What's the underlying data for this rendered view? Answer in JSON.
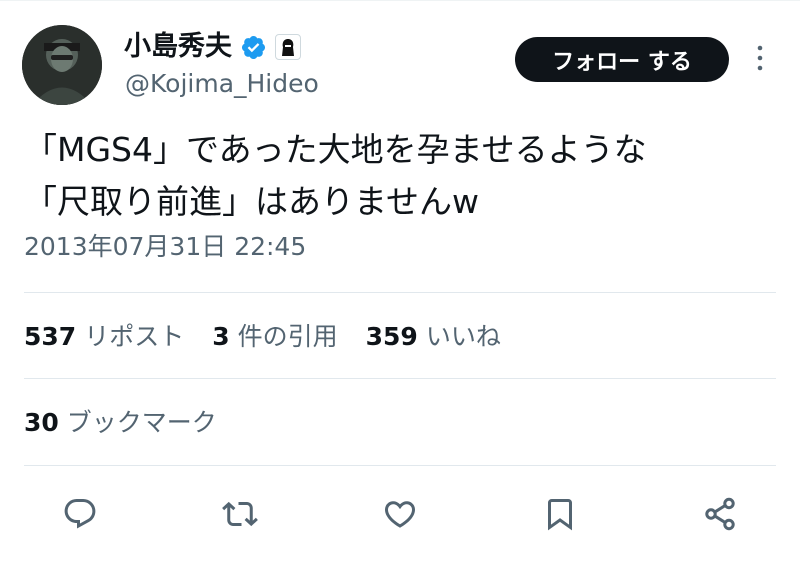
{
  "author": {
    "display_name": "小島秀夫",
    "handle": "@Kojima_Hideo"
  },
  "follow_label": "フォロー する",
  "tweet": {
    "line1": "「MGS4」であった大地を孕ませるような",
    "line2": "「尺取り前進」はありませんw",
    "timestamp": "2013年07月31日 22:45"
  },
  "stats": {
    "reposts_count": "537",
    "reposts_label": "リポスト",
    "quotes_count": "3",
    "quotes_label": "件の引用",
    "likes_count": "359",
    "likes_label": "いいね",
    "bookmarks_count": "30",
    "bookmarks_label": "ブックマーク"
  },
  "icons": {
    "verified": "verified-badge-icon",
    "affiliate": "affiliate-badge-icon",
    "more": "more-vertical-icon",
    "reply": "reply-icon",
    "repost": "repost-icon",
    "like": "heart-icon",
    "bookmark": "bookmark-icon",
    "share": "share-icon"
  },
  "colors": {
    "text": "#0f1419",
    "secondary": "#536471",
    "verified_blue": "#1d9bf0",
    "follow_bg": "#0f1419"
  }
}
